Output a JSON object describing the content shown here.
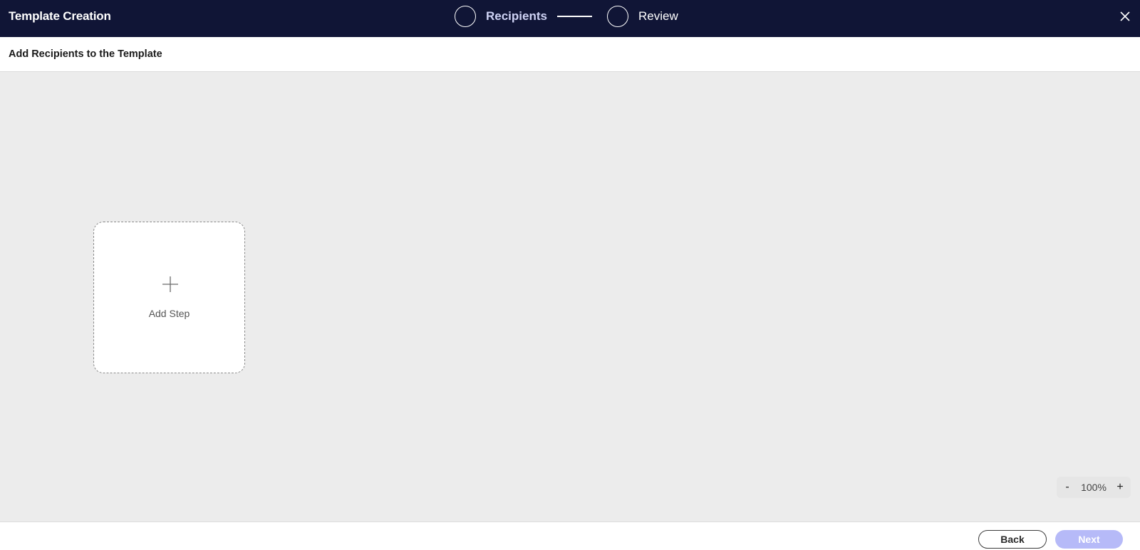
{
  "header": {
    "title": "Template Creation",
    "close_icon": "close-icon",
    "background_color": "#101536"
  },
  "stepper": {
    "steps": [
      {
        "label": "Recipients",
        "state": "active"
      },
      {
        "label": "Review",
        "state": "upcoming"
      }
    ]
  },
  "subheader": {
    "title": "Add Recipients to the Template"
  },
  "canvas": {
    "add_step": {
      "icon": "plus-icon",
      "label": "Add Step"
    },
    "zoom": {
      "decrease_label": "-",
      "value": "100%",
      "increase_label": "+"
    }
  },
  "footer": {
    "back_label": "Back",
    "next_label": "Next",
    "next_state": "disabled",
    "next_color": "#b6baf8"
  }
}
